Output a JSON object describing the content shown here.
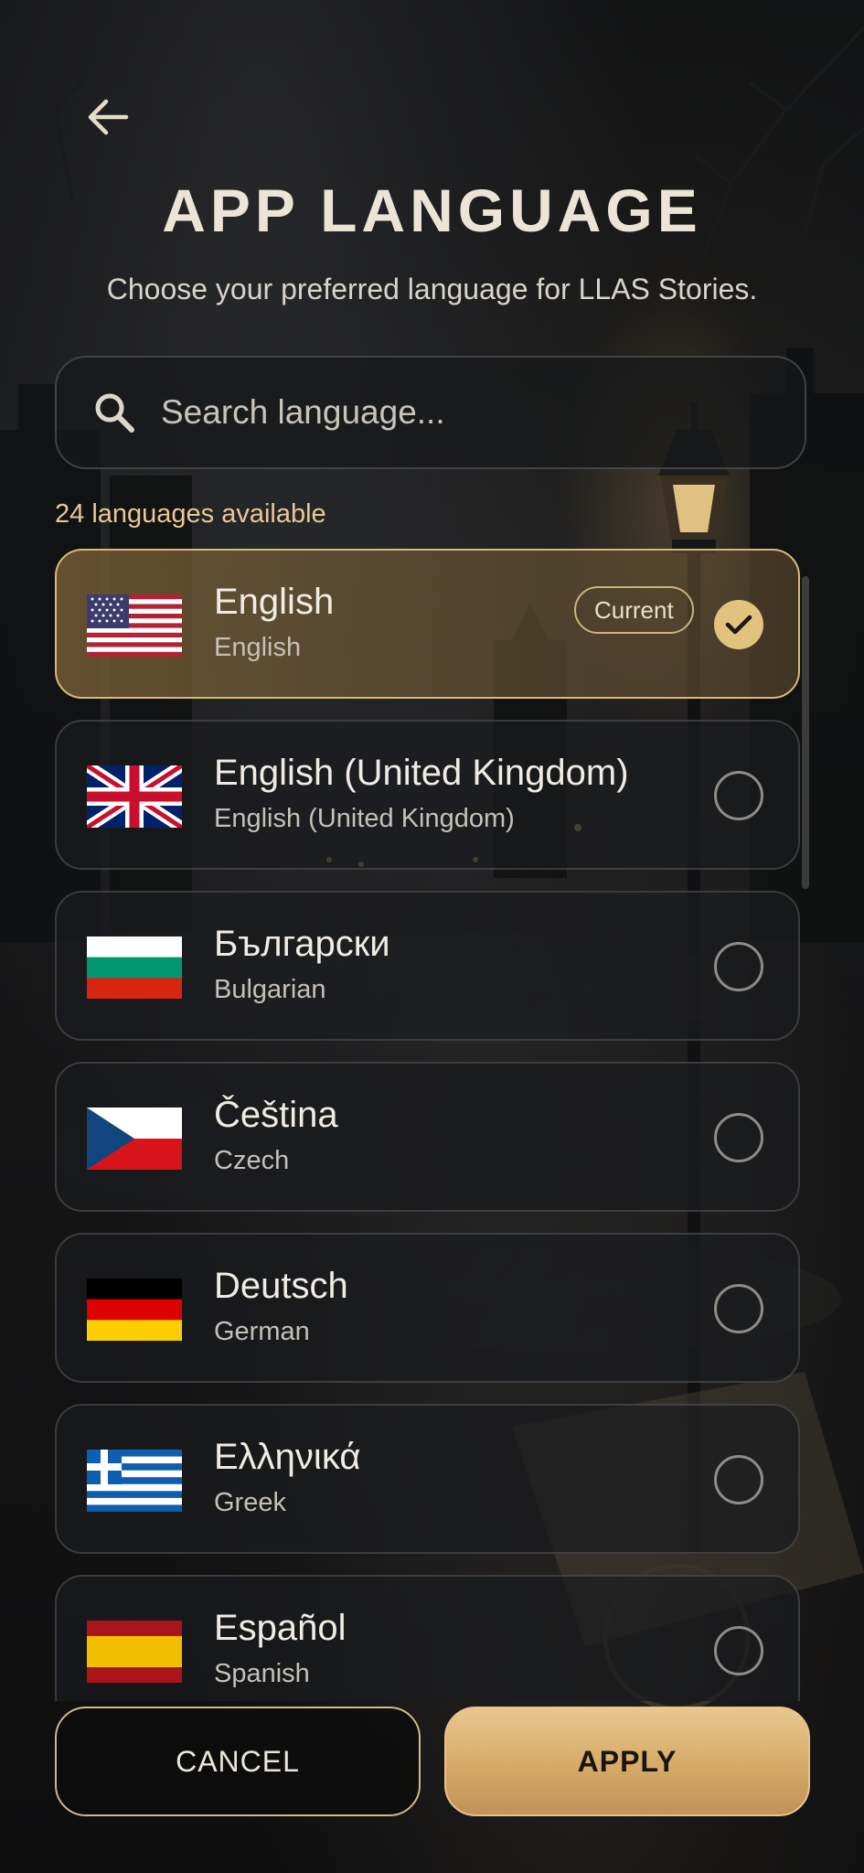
{
  "header": {
    "back_icon": "arrow-left-icon",
    "title": "APP LANGUAGE",
    "subtitle": "Choose your preferred language for LLAS Stories."
  },
  "search": {
    "icon": "search-icon",
    "placeholder": "Search language...",
    "value": ""
  },
  "count_text": "24 languages available",
  "current_badge": "Current",
  "languages": [
    {
      "native": "English",
      "english": "English",
      "flag": "us-flag-icon",
      "selected": true
    },
    {
      "native": "English (United Kingdom)",
      "english": "English (United Kingdom)",
      "flag": "uk-flag-icon",
      "selected": false
    },
    {
      "native": "Български",
      "english": "Bulgarian",
      "flag": "bulgaria-flag-icon",
      "selected": false
    },
    {
      "native": "Čeština",
      "english": "Czech",
      "flag": "czech-flag-icon",
      "selected": false
    },
    {
      "native": "Deutsch",
      "english": "German",
      "flag": "germany-flag-icon",
      "selected": false
    },
    {
      "native": "Ελληνικά",
      "english": "Greek",
      "flag": "greece-flag-icon",
      "selected": false
    },
    {
      "native": "Español",
      "english": "Spanish",
      "flag": "spain-flag-icon",
      "selected": false
    }
  ],
  "buttons": {
    "cancel": "CANCEL",
    "apply": "APPLY"
  },
  "colors": {
    "accent_gold": "#e2c27f",
    "title_text": "#ece4d6",
    "count_text": "#e6c996"
  }
}
